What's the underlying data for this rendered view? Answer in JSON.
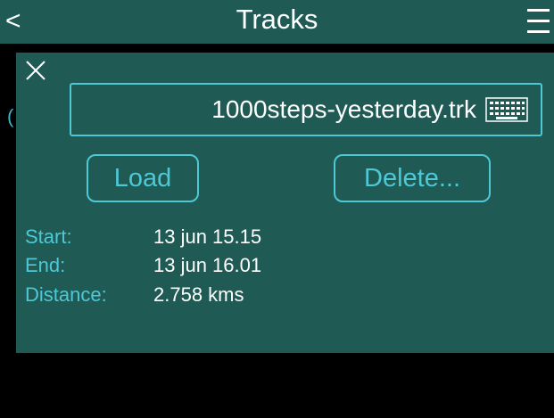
{
  "header": {
    "back_label": "<",
    "title": "Tracks",
    "menu_icon": "hamburger-menu-icon"
  },
  "background": {
    "partial_glyph": "("
  },
  "dialog": {
    "close_icon": "close-icon",
    "filename": "1000steps-yesterday.trk",
    "keyboard_icon": "keyboard-icon",
    "load_label": "Load",
    "delete_label": "Delete...",
    "info": [
      {
        "label": "Start:",
        "value": "13 jun 15.15"
      },
      {
        "label": "End:",
        "value": "13 jun 16.01"
      },
      {
        "label": "Distance:",
        "value": "2.758 kms"
      }
    ]
  },
  "colors": {
    "header_bg": "#1f5a55",
    "dialog_bg": "#1f5a55",
    "accent": "#4dc9d6",
    "text": "#ffffff",
    "background": "#000000"
  }
}
